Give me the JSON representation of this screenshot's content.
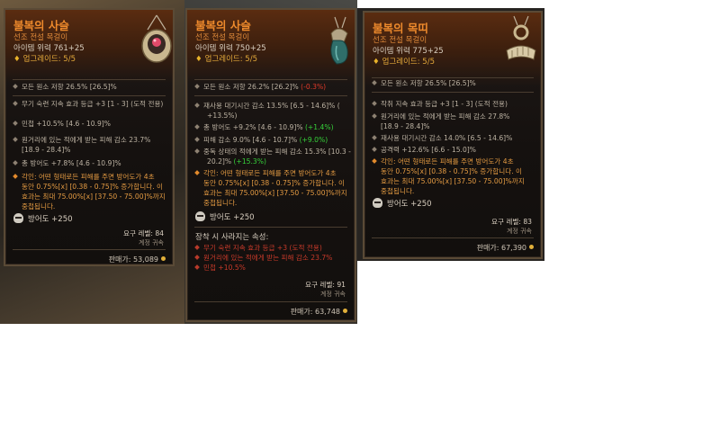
{
  "cards": [
    {
      "title": "불복의 사슬",
      "rarity": "선조 전설 목걸이",
      "item_power": "아이템 위력 761+25",
      "upgrade": "업그레이드: 5/5",
      "base_affix": "모든 원소 저항 26.5% [26.5]%",
      "affixes": [
        "무기 숙련 지속 효과 등급 +3 [1 - 3] (도적 전용)",
        "민첩 +10.5% [4.6 - 10.9]%",
        "원거리에 있는 적에게 받는 피해 감소 23.7%",
        "[18.9 - 28.4]%",
        "총 방어도 +7.8% [4.6 - 10.9]%"
      ],
      "aspect_lines": [
        "각인: 어떤 형태로든 피해를 주면 방어도가 4초",
        "동안 0.75%[x] [0.38 - 0.75]% 증가합니다. 이",
        "효과는 최대 75.00%[x] [37.50 - 75.00]%까지",
        "중첩됩니다."
      ],
      "armor": "방어도 +250",
      "req_level": "요구 레벨: 84",
      "bound": "계정 귀속",
      "sell": "판매가: 53,089"
    },
    {
      "title": "불복의 사슬",
      "rarity": "선조 전설 목걸이",
      "item_power": "아이템 위력 750+25",
      "upgrade": "업그레이드: 5/5",
      "base_affix": "모든 원소 저항 26.2% [26.2]%",
      "base_affix_delta": "(-0.3%)",
      "affixes": [
        "재사용 대기시간 감소 13.5% [6.5 - 14.6]% (",
        "+13.5%)",
        "총 방어도 +9.2% [4.6 - 10.9]%",
        "(+1.4%)",
        "피해 감소 9.0% [4.6 - 10.7]%",
        "(+9.0%)",
        "중독 상태의 적에게 받는 피해 감소 15.3% [10.3 -",
        "20.2]%",
        "(+15.3%)"
      ],
      "aspect_lines": [
        "각인: 어떤 형태로든 피해를 주면 방어도가 4초",
        "동안 0.75%[x] [0.38 - 0.75]% 증가합니다. 이",
        "효과는 최대 75.00%[x] [37.50 - 75.00]%까지",
        "중첩됩니다."
      ],
      "armor": "방어도 +250",
      "unequip_title": "장착 시 사라지는 속성:",
      "lost": [
        "무기 숙련 지속 효과 등급 +3 (도적 전용)",
        "원거리에 있는 적에게 받는 피해 감소 23.7%",
        "민첩 +10.5%"
      ],
      "req_level": "요구 레벨: 91",
      "bound": "계정 귀속",
      "sell": "판매가: 63,748"
    },
    {
      "title": "불복의 목띠",
      "rarity": "선조 전설 목걸이",
      "item_power": "아이템 위력 775+25",
      "upgrade": "업그레이드: 5/5",
      "base_affix": "모든 원소 저항 26.5% [26.5]%",
      "affixes": [
        "작취 지속 효과 등급 +3 [1 - 3] (도적 전용)",
        "원거리에 있는 적에게 받는 피해 감소 27.8%",
        "[18.9 - 28.4]%",
        "재사용 대기시간 감소 14.0% [6.5 - 14.6]%",
        "공격력 +12.6% [6.6 - 15.0]%"
      ],
      "aspect_lines": [
        "각인: 어떤 형태로든 피해를 주면 방어도가 4초",
        "동안 0.75%[x] [0.38 - 0.75]% 증가합니다. 이",
        "효과는 최대 75.00%[x] [37.50 - 75.00]%까지",
        "중첩됩니다."
      ],
      "armor": "방어도 +250",
      "req_level": "요구 레벨: 83",
      "bound": "계정 귀속",
      "sell": "판매가: 67,390"
    }
  ],
  "colors": {
    "title": "#ee8a2c",
    "green_delta": "#36d13a",
    "red_delta": "#e03a2a",
    "aspect": "#e39a42"
  },
  "icons": [
    "amulet-red-gem-icon",
    "amulet-blue-gem-icon",
    "amulet-ring-icon",
    "skull-icon",
    "gold-coin-icon",
    "upgrade-star-icon"
  ]
}
